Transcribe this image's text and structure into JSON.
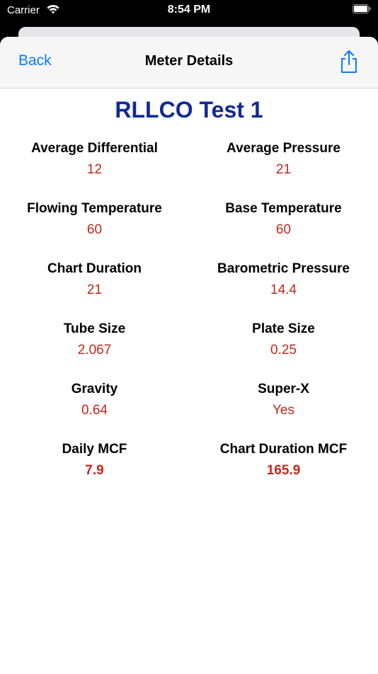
{
  "status_bar": {
    "carrier": "Carrier",
    "time": "8:54 PM"
  },
  "nav": {
    "back_label": "Back",
    "title": "Meter Details",
    "share_icon": "share-icon"
  },
  "meter_name": "RLLCO Test 1",
  "details": [
    [
      {
        "label": "Average Differential",
        "value": "12"
      },
      {
        "label": "Average Pressure",
        "value": "21"
      }
    ],
    [
      {
        "label": "Flowing Temperature",
        "value": "60"
      },
      {
        "label": "Base Temperature",
        "value": "60"
      }
    ],
    [
      {
        "label": "Chart Duration",
        "value": "21"
      },
      {
        "label": "Barometric Pressure",
        "value": "14.4"
      }
    ],
    [
      {
        "label": "Tube Size",
        "value": "2.067"
      },
      {
        "label": "Plate Size",
        "value": "0.25"
      }
    ],
    [
      {
        "label": "Gravity",
        "value": "0.64"
      },
      {
        "label": "Super-X",
        "value": "Yes"
      }
    ],
    [
      {
        "label": "Daily MCF",
        "value": "7.9"
      },
      {
        "label": "Chart Duration MCF",
        "value": "165.9"
      }
    ]
  ],
  "colors": {
    "accent": "#0a7aff",
    "title": "#102a96",
    "value": "#c2281a"
  }
}
